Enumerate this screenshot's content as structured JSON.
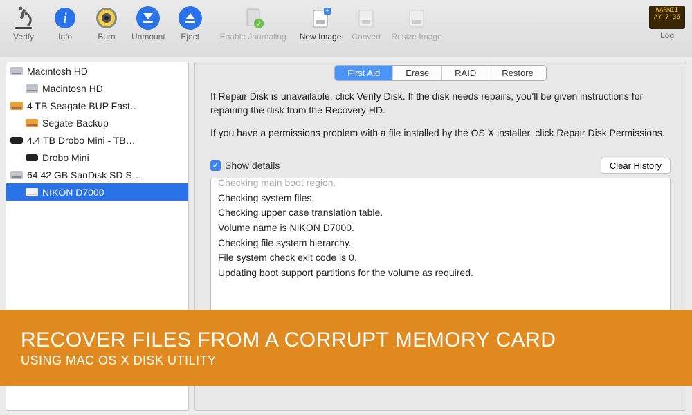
{
  "toolbar": {
    "items": [
      {
        "label": "Verify",
        "icon": "microscope",
        "enabled": true
      },
      {
        "label": "Info",
        "icon": "info",
        "enabled": true
      },
      {
        "label": "Burn",
        "icon": "burn",
        "enabled": true
      },
      {
        "label": "Unmount",
        "icon": "unmount",
        "enabled": true
      },
      {
        "label": "Eject",
        "icon": "eject",
        "enabled": true
      },
      {
        "label": "Enable Journaling",
        "icon": "journal",
        "enabled": false
      },
      {
        "label": "New Image",
        "icon": "new-image",
        "enabled": true
      },
      {
        "label": "Convert",
        "icon": "convert",
        "enabled": false
      },
      {
        "label": "Resize Image",
        "icon": "resize",
        "enabled": false
      }
    ],
    "log_label": "Log",
    "log_widget": {
      "line1": "WARNII",
      "line2": "AY 7:36"
    }
  },
  "sidebar": {
    "items": [
      {
        "label": "Macintosh HD",
        "icon": "hdd-silver",
        "indent": 0
      },
      {
        "label": "Macintosh HD",
        "icon": "hdd-silver",
        "indent": 1
      },
      {
        "label": "4 TB Seagate BUP Fast…",
        "icon": "hdd-orange",
        "indent": 0
      },
      {
        "label": "Segate-Backup",
        "icon": "hdd-orange",
        "indent": 1
      },
      {
        "label": "4.4 TB Drobo Mini - TB…",
        "icon": "hdd-black",
        "indent": 0
      },
      {
        "label": "Drobo Mini",
        "icon": "hdd-black",
        "indent": 1
      },
      {
        "label": "64.42 GB SanDisk SD S…",
        "icon": "hdd-silver",
        "indent": 0
      },
      {
        "label": "NIKON D7000",
        "icon": "hdd-white",
        "indent": 1,
        "selected": true
      }
    ]
  },
  "main": {
    "tabs": [
      {
        "label": "First Aid",
        "active": true
      },
      {
        "label": "Erase",
        "active": false
      },
      {
        "label": "RAID",
        "active": false
      },
      {
        "label": "Restore",
        "active": false
      }
    ],
    "instructions": [
      "If Repair Disk is unavailable, click Verify Disk. If the disk needs repairs, you'll be given instructions for repairing the disk from the Recovery HD.",
      "If you have a permissions problem with a file installed by the OS X installer, click Repair Disk Permissions."
    ],
    "show_details_label": "Show details",
    "show_details_checked": true,
    "clear_history_label": "Clear History",
    "log_lines": [
      "Checking main boot region.",
      "Checking system files.",
      "Checking upper case translation table.",
      "Volume name is NIKON D7000.",
      "Checking file system hierarchy.",
      "",
      "",
      "",
      "",
      "File system check exit code is 0.",
      "Updating boot support partitions for the volume as required."
    ]
  },
  "banner": {
    "title": "RECOVER FILES FROM A CORRUPT MEMORY CARD",
    "subtitle": "USING MAC OS X DISK UTILITY"
  },
  "icons": {
    "hdd_silver": "#c0c4cc",
    "hdd_orange": "#e8a038",
    "hdd_black": "#222",
    "hdd_white": "#f4f4f4"
  }
}
